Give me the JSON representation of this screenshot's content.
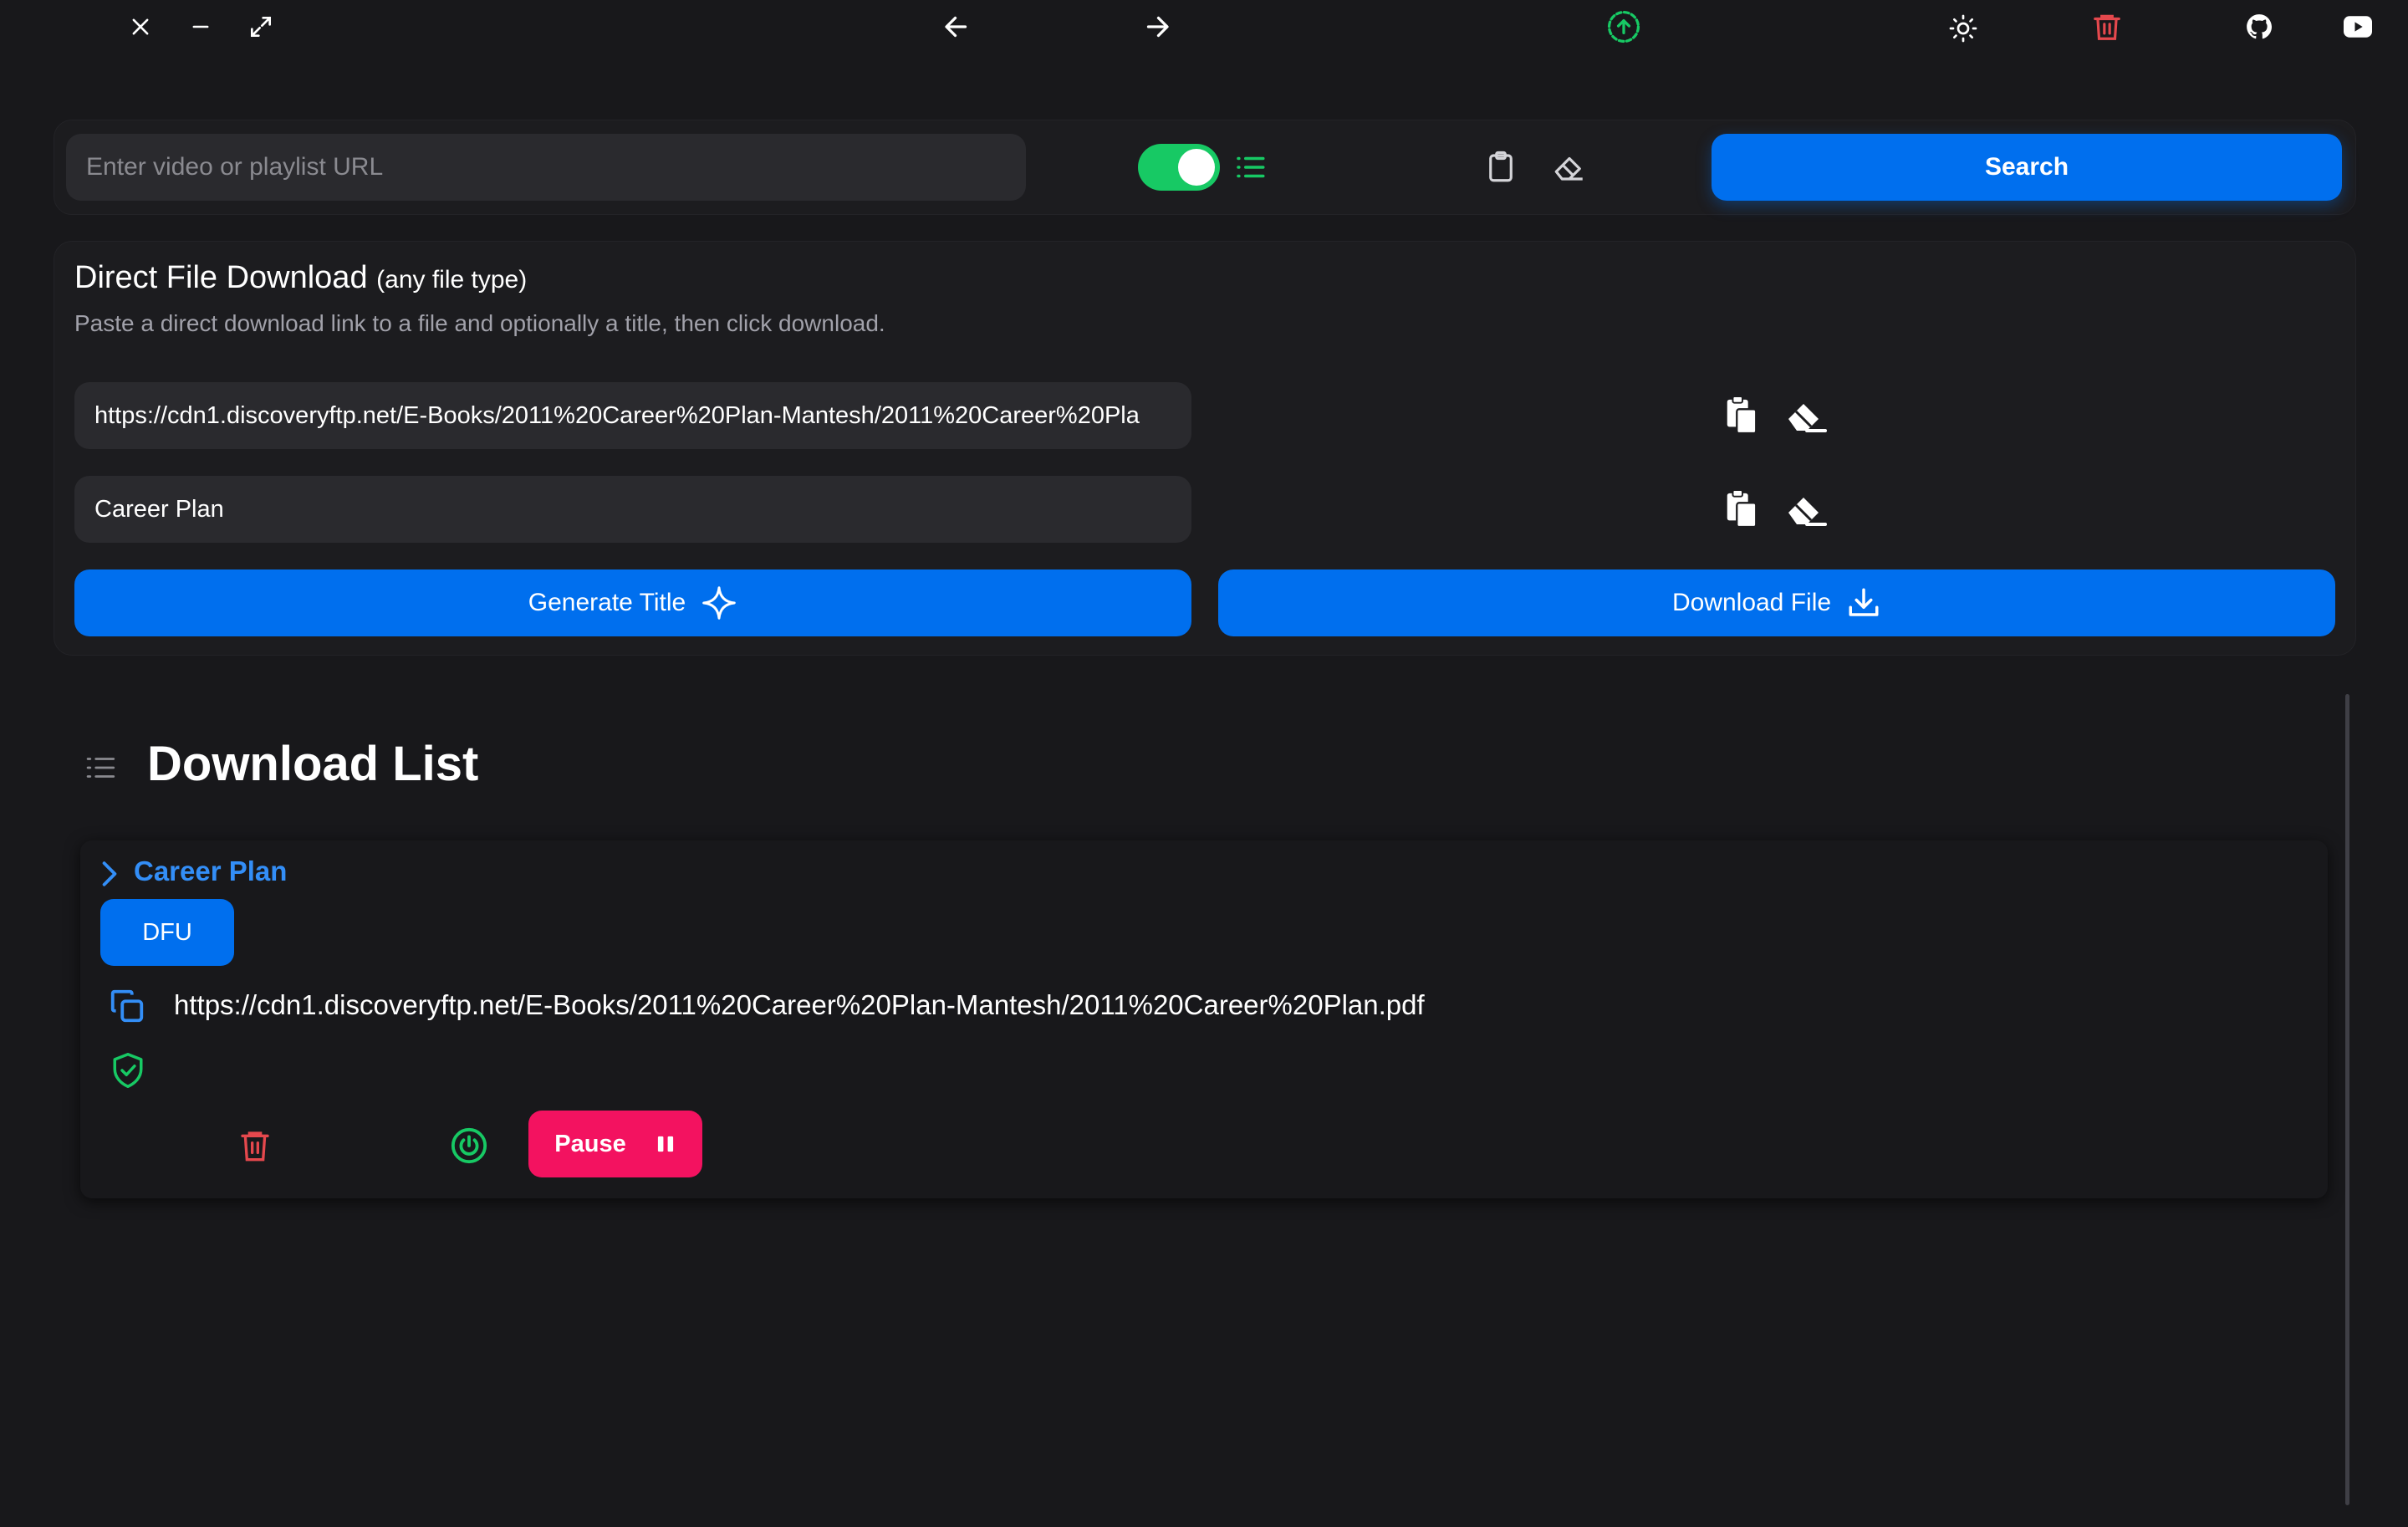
{
  "window": {
    "icons": [
      "close-icon",
      "minimize-icon",
      "maximize-icon"
    ]
  },
  "nav": {
    "icons": [
      "arrow-left-icon",
      "arrow-right-icon",
      "upload-circle-icon"
    ]
  },
  "toolbar_right": {
    "icons": [
      "sun-icon",
      "trash-icon",
      "github-icon",
      "youtube-icon"
    ]
  },
  "search": {
    "placeholder": "Enter video or playlist URL",
    "value": "",
    "toggle_on": true,
    "button_label": "Search"
  },
  "direct_download": {
    "title": "Direct File Download",
    "title_suffix": "(any file type)",
    "description": "Paste a direct download link to a file and optionally a title, then click download.",
    "url_value": "https://cdn1.discoveryftp.net/E-Books/2011%20Career%20Plan-Mantesh/2011%20Career%20Pla",
    "title_value": "Career Plan",
    "generate_label": "Generate Title",
    "download_label": "Download File"
  },
  "download_list": {
    "title": "Download List",
    "items": [
      {
        "name": "Career Plan",
        "badge": "DFU",
        "url": "https://cdn1.discoveryftp.net/E-Books/2011%20Career%20Plan-Mantesh/2011%20Career%20Plan.pdf",
        "pause_label": "Pause"
      }
    ]
  },
  "colors": {
    "background": "#18181b",
    "primary": "#006fee",
    "success": "#17c964",
    "danger": "#f31260",
    "trash_red": "#e5484d",
    "link_blue": "#338ef7"
  }
}
